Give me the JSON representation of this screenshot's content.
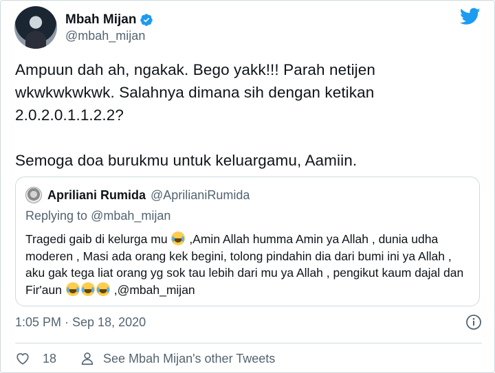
{
  "author": {
    "display_name": "Mbah Mijan",
    "handle": "@mbah_mijan",
    "verified": true
  },
  "tweet": {
    "line1": "Ampuun dah ah, ngakak. Bego yakk!!! Parah netijen",
    "line2": "wkwkwkwkwk. Salahnya dimana sih dengan ketikan",
    "line3": "2.0.2.0.1.1.2.2?",
    "line4": "Semoga doa burukmu untuk keluargamu, Aamiin."
  },
  "quoted_tweet": {
    "display_name": "Apriliani Rumida",
    "handle": "@AprilianiRumida",
    "replying_prefix": "Replying to",
    "replying_to": "@mbah_mijan",
    "text_part1": "Tragedi gaib di kelurga mu",
    "text_part2": ",Amin Allah humma Amin ya Allah , dunia udha moderen , Masi ada orang kek begini, tolong pindahin dia dari bumi ini ya Allah , aku gak tega liat orang yg sok tau lebih dari mu ya Allah , pengikut kaum dajal dan Fir'aun",
    "text_part3": ",@mbah_mijan"
  },
  "meta": {
    "timestamp": "1:05 PM · Sep 18, 2020"
  },
  "actions": {
    "like_count": "18",
    "other_tweets_label": "See Mbah Mijan's other Tweets"
  },
  "colors": {
    "twitter_blue": "#1d9bf0",
    "secondary_text": "#536471",
    "border": "#cfd9de"
  },
  "icons": {
    "logo": "twitter-bird-icon",
    "verified": "verified-badge-icon",
    "info": "info-icon",
    "like": "heart-icon",
    "profile": "person-icon",
    "emoji": "face-with-tears-of-joy-emoji"
  }
}
